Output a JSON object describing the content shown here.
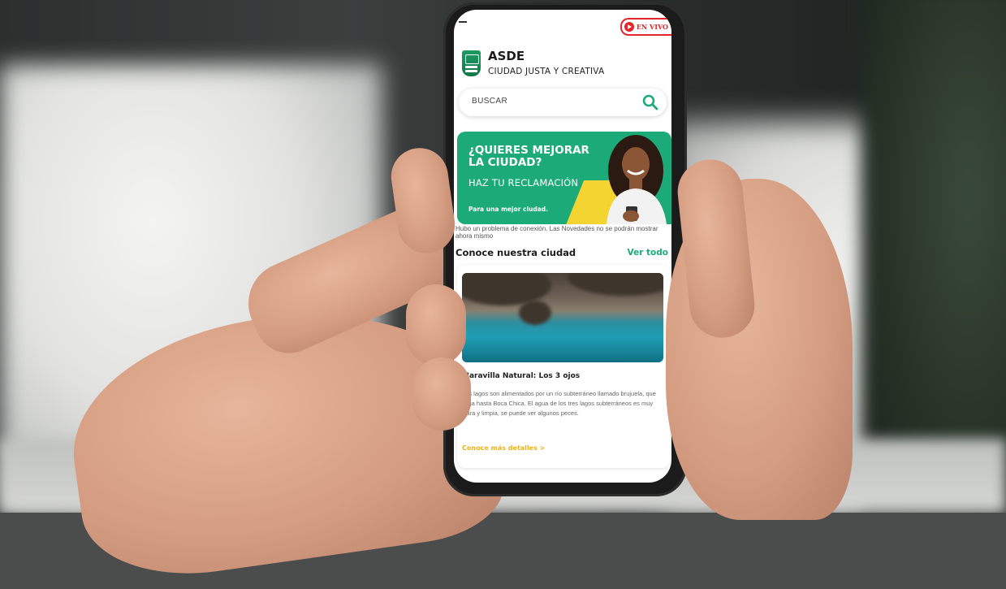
{
  "header": {
    "live_label": "EN VIVO",
    "brand_title": "ASDE",
    "brand_subtitle": "CIUDAD JUSTA Y CREATIVA"
  },
  "search": {
    "placeholder": "BUSCAR"
  },
  "banner": {
    "title": "¿QUIERES MEJORAR LA CIUDAD?",
    "cta": "HAZ TU RECLAMACIÓN",
    "note": "Para una mejor ciudad."
  },
  "news": {
    "error_message": "Hubo un problema de conexión. Las Novedades no se podrán mostrar ahora mismo"
  },
  "section": {
    "title": "Conoce nuestra ciudad",
    "see_all": "Ver todo"
  },
  "card": {
    "title": "Maravilla Natural: Los 3 ojos",
    "body": "Los lagos son alimentados por un río subterráneo llamado brujuela, que llega hasta Boca Chica. El agua de los tres lagos subterráneos es muy clara y limpia, se puede ver algunos peces.",
    "link": "Conoce más detalles >"
  },
  "colors": {
    "brand_green": "#1cab78",
    "accent_yellow": "#f4d431",
    "live_red": "#e3262b",
    "link_orange": "#f0b21a"
  },
  "icons": [
    "menu-icon",
    "live-play-icon",
    "asde-logo",
    "search-icon"
  ]
}
